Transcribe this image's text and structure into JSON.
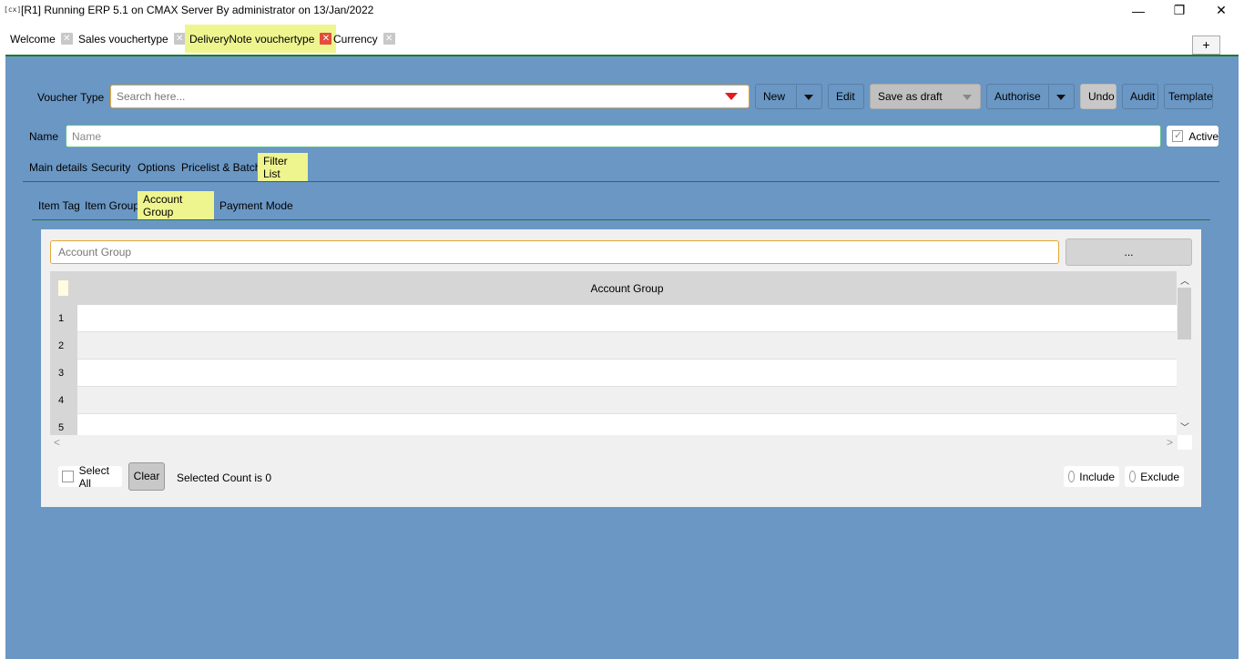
{
  "window": {
    "icon": "[cx]",
    "title": "[R1] Running ERP 5.1 on CMAX Server By administrator on 13/Jan/2022",
    "minimize": "—",
    "maximize": "❐",
    "close": "✕"
  },
  "tabs": [
    {
      "label": "Welcome"
    },
    {
      "label": "Sales vouchertype"
    },
    {
      "label": "DeliveryNote vouchertype"
    },
    {
      "label": "Currency"
    }
  ],
  "tab_close_glyph": "✕",
  "plus_label": "+",
  "toolbar": {
    "voucher_type_label": "Voucher Type",
    "search_placeholder": "Search here...",
    "new_label": "New",
    "edit_label": "Edit",
    "save_draft_label": "Save as draft",
    "authorise_label": "Authorise",
    "undo_label": "Undo",
    "audit_label": "Audit",
    "template_label": "Template"
  },
  "name_row": {
    "label": "Name",
    "placeholder": "Name",
    "active_label": "Active",
    "active_checked": true
  },
  "main_tabs": [
    "Main details",
    "Security",
    "Options",
    "Pricelist & Batch",
    "Filter List"
  ],
  "sub_tabs": [
    "Item Tag",
    "Item Group",
    "Account Group",
    "Payment Mode"
  ],
  "filter_panel": {
    "input_placeholder": "Account Group",
    "ellipsis_label": "...",
    "column_header": "Account Group",
    "rows": [
      "1",
      "2",
      "3",
      "4",
      "5"
    ],
    "select_all_label": "Select All",
    "clear_label": "Clear",
    "selected_count_text": "Selected Count is 0",
    "include_label": "Include",
    "exclude_label": "Exclude",
    "scroll_up": "︿",
    "scroll_down": "﹀",
    "scroll_left": "<",
    "scroll_right": ">"
  },
  "colors": {
    "main_bg": "#6a97c4",
    "active_tab": "#eef58f",
    "accent_green": "#1e7a2c",
    "input_border": "#e5a83a",
    "dropdown_arrow": "#e41b1b"
  }
}
